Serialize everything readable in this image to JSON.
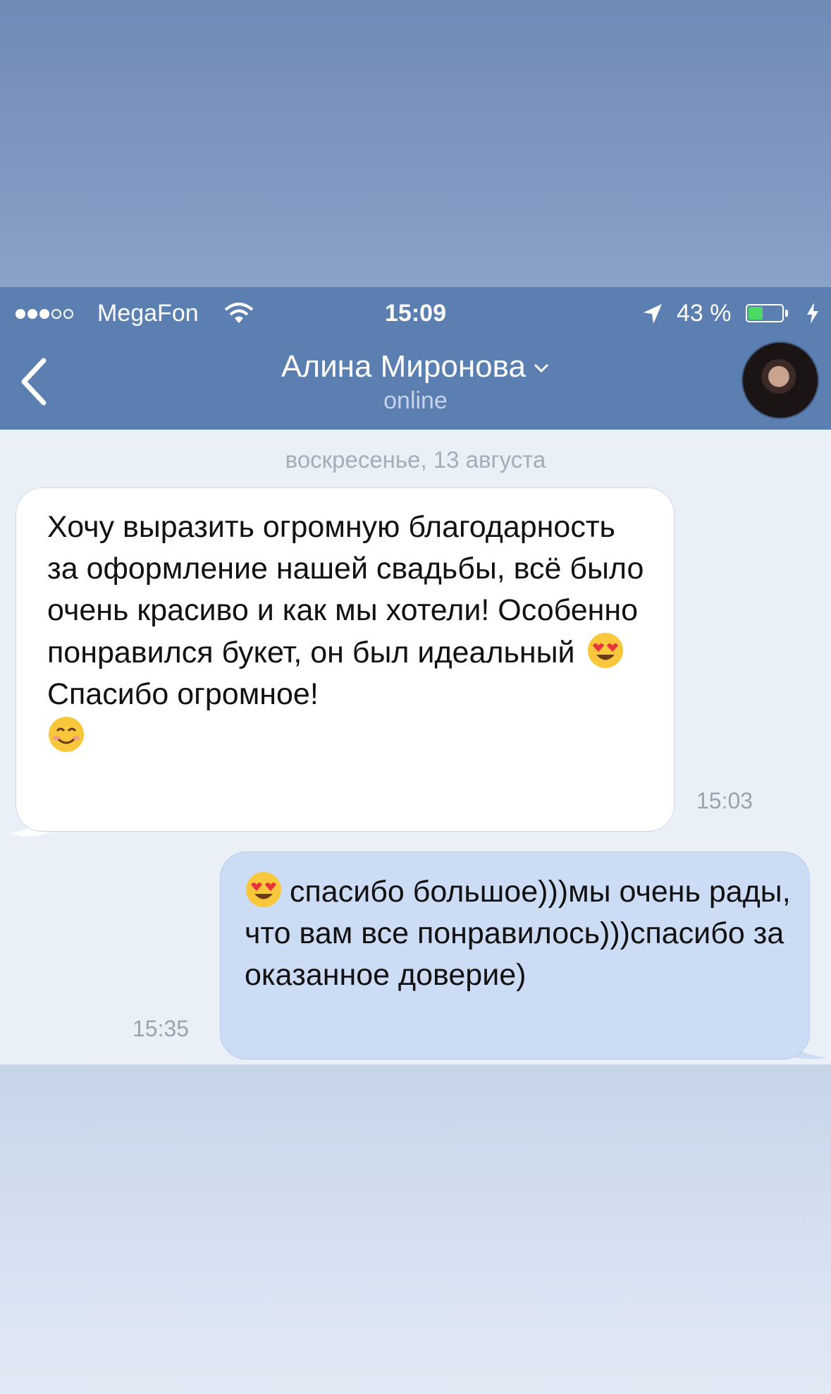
{
  "status_bar": {
    "carrier": "MegaFon",
    "time": "15:09",
    "battery_percent": "43 %",
    "battery_level": 0.43,
    "signal_bars_filled": 3,
    "signal_bars_total": 5
  },
  "header": {
    "contact_name": "Алина Миронова",
    "contact_status": "online"
  },
  "chat": {
    "date_separator": "воскресенье, 13 августа",
    "messages": [
      {
        "direction": "incoming",
        "text_part1": "Хочу выразить огромную благодарность за оформление нашей свадьбы, всё было очень красиво и как мы хотели! Особенно понравился букет, он был идеальный",
        "emoji1": "heart-eyes",
        "text_part2": "Спасибо огромное!",
        "emoji2": "smiling-face",
        "time": "15:03"
      },
      {
        "direction": "outgoing",
        "emoji": "heart-eyes",
        "text": "спасибо большое)))мы очень рады, что вам все понравилось)))спасибо за оказанное доверие)",
        "time": "15:35"
      }
    ]
  },
  "colors": {
    "header_bg": "#5b7fb1",
    "chat_bg": "#eaf0f8",
    "incoming_bubble": "#ffffff",
    "outgoing_bubble": "#ccdcf5",
    "battery_fill": "#4cd964"
  }
}
